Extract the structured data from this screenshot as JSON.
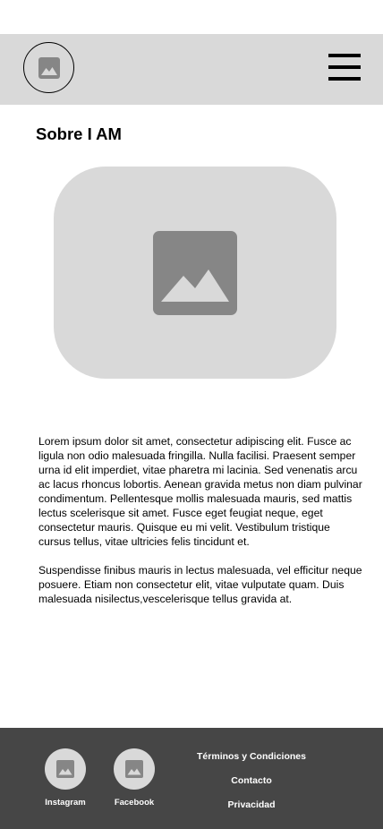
{
  "header": {
    "logo_icon": "image-placeholder-icon",
    "menu_icon": "hamburger-menu-icon"
  },
  "main": {
    "title": "Sobre I AM",
    "hero_icon": "image-placeholder-icon",
    "paragraphs": [
      "Lorem ipsum dolor sit amet, consectetur adipiscing elit. Fusce ac ligula non odio malesuada fringilla. Nulla facilisi. Praesent semper urna id elit imperdiet, vitae pharetra mi lacinia. Sed venenatis arcu ac lacus rhoncus lobortis. Aenean gravida metus non diam pulvinar condimentum. Pellentesque mollis malesuada mauris, sed mattis lectus scelerisque sit amet. Fusce eget feugiat neque, eget consectetur mauris. Quisque eu mi velit. Vestibulum tristique cursus tellus, vitae ultricies felis tincidunt et.",
      "Suspendisse finibus mauris in lectus malesuada, vel efficitur neque posuere. Etiam non consectetur elit, vitae vulputate quam. Duis malesuada nisilectus,vescelerisque tellus gravida at."
    ]
  },
  "footer": {
    "social": [
      {
        "label": "Instagram",
        "icon": "image-placeholder-icon"
      },
      {
        "label": "Facebook",
        "icon": "image-placeholder-icon"
      }
    ],
    "links": [
      "Términos y Condiciones",
      "Contacto",
      "Privacidad"
    ]
  },
  "colors": {
    "header_bg": "#d9d9d9",
    "placeholder_bg": "#d9d9d9",
    "placeholder_icon": "#868686",
    "footer_bg": "#464646",
    "footer_text": "#ffffff"
  }
}
